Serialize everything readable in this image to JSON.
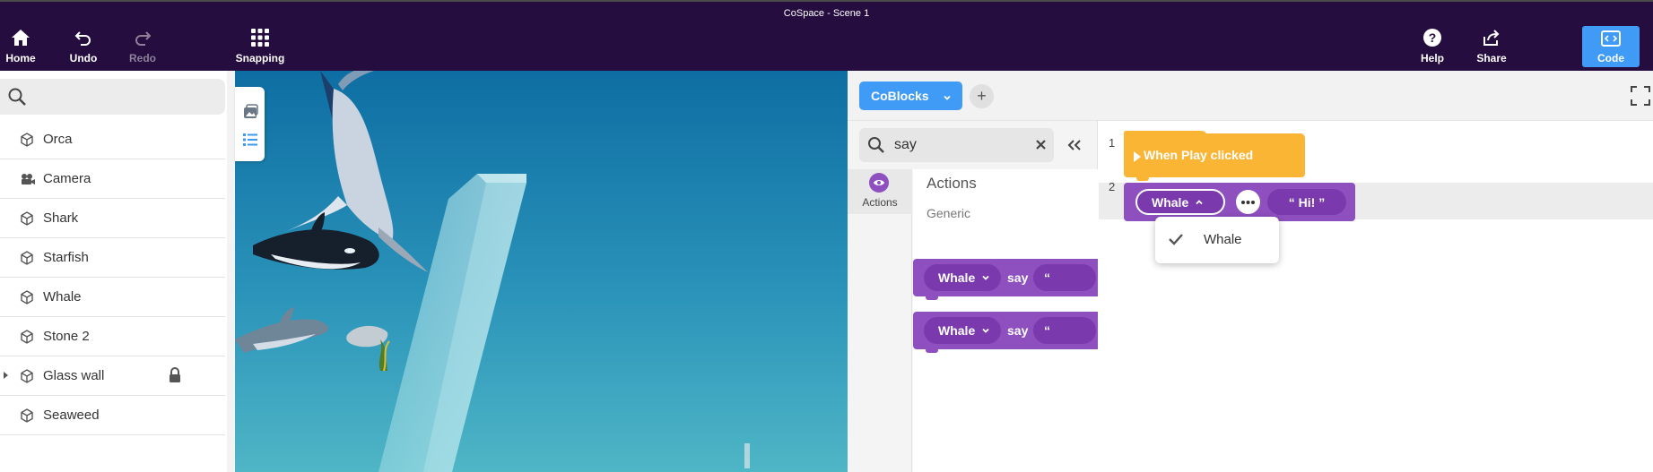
{
  "window": {
    "title": "CoSpace - Scene 1"
  },
  "toolbar": {
    "home": {
      "label": "Home",
      "icon": "home-icon"
    },
    "undo": {
      "label": "Undo",
      "icon": "undo-icon"
    },
    "redo": {
      "label": "Redo",
      "icon": "redo-icon",
      "disabled": true
    },
    "snapping": {
      "label": "Snapping",
      "icon": "grid-icon"
    },
    "help": {
      "label": "Help",
      "icon": "help-icon"
    },
    "share": {
      "label": "Share",
      "icon": "share-icon"
    },
    "code": {
      "label": "Code",
      "icon": "code-icon",
      "active": true
    }
  },
  "objects": {
    "search_placeholder": "",
    "items": [
      {
        "label": "Orca",
        "icon": "cube-icon"
      },
      {
        "label": "Camera",
        "icon": "camera-icon"
      },
      {
        "label": "Shark",
        "icon": "cube-icon"
      },
      {
        "label": "Starfish",
        "icon": "cube-icon"
      },
      {
        "label": "Whale",
        "icon": "cube-icon"
      },
      {
        "label": "Stone 2",
        "icon": "cube-icon"
      },
      {
        "label": "Glass wall",
        "icon": "cube-icon",
        "expandable": true,
        "locked": true
      },
      {
        "label": "Seaweed",
        "icon": "cube-icon"
      }
    ]
  },
  "scene": {
    "tabs": [
      {
        "icon": "gallery-icon"
      },
      {
        "icon": "list-icon"
      }
    ]
  },
  "code": {
    "editor_button": "CoBlocks",
    "add_button": "+",
    "palette": {
      "search_value": "say",
      "category": "Actions",
      "title": "Actions",
      "subtitle": "Generic",
      "blocks": [
        {
          "target": "Whale",
          "verb": "say",
          "quote": "“"
        },
        {
          "target": "Whale",
          "verb": "say",
          "quote": "“"
        }
      ]
    },
    "canvas": {
      "lines": [
        "1",
        "2"
      ],
      "hat_block": "When Play clicked",
      "statement": {
        "target": "Whale",
        "text": "“ Hi! ”"
      },
      "dropdown": {
        "selected": "Whale"
      }
    }
  },
  "colors": {
    "topbar": "#250d3f",
    "accent": "#3f9bf5",
    "block_purple": "#8e4fbf",
    "block_orange": "#fbb535"
  }
}
